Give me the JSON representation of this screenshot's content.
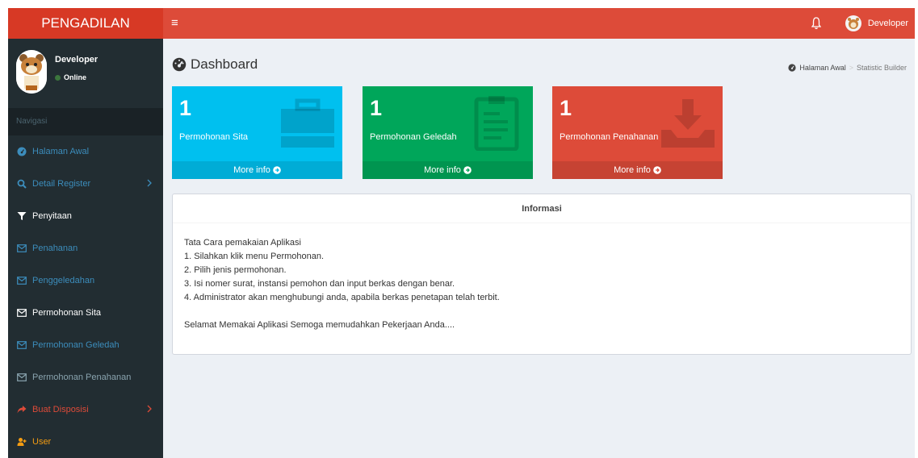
{
  "header": {
    "logo": "PENGADILAN",
    "toggle_icon": "≡",
    "user_label": "Developer"
  },
  "sidebar": {
    "user_name": "Developer",
    "user_status": "Online",
    "section_header": "Navigasi",
    "items": [
      {
        "label": "Halaman Awal",
        "icon": "dashboard-icon",
        "color": "#3c8dbc"
      },
      {
        "label": "Detail Register",
        "icon": "search-icon",
        "color": "#3c8dbc"
      },
      {
        "label": "Penyitaan",
        "icon": "filter-icon",
        "color": "#ffffff"
      },
      {
        "label": "Penahanan",
        "icon": "envelope-icon",
        "color": "#3c8dbc"
      },
      {
        "label": "Penggeledahan",
        "icon": "envelope-icon",
        "color": "#3c8dbc"
      },
      {
        "label": "Permohonan Sita",
        "icon": "envelope-icon",
        "color": "#ffffff"
      },
      {
        "label": "Permohonan Geledah",
        "icon": "envelope-icon",
        "color": "#3c8dbc"
      },
      {
        "label": "Permohonan Penahanan",
        "icon": "envelope-icon",
        "color": "#8aa4af"
      },
      {
        "label": "Buat Disposisi",
        "icon": "share-icon",
        "color": "#dd4b39"
      },
      {
        "label": "User",
        "icon": "user-plus-icon",
        "color": "#f39c12"
      }
    ]
  },
  "content": {
    "title": "Dashboard",
    "breadcrumb": [
      "Halaman Awal",
      "Statistic Builder"
    ]
  },
  "stats": [
    {
      "count": "1",
      "label": "Permohonan Sita",
      "more": "More info",
      "color": "#00c0ef",
      "icon": "briefcase-icon"
    },
    {
      "count": "1",
      "label": "Permohonan Geledah",
      "more": "More info",
      "color": "#00a65a",
      "icon": "clipboard-icon"
    },
    {
      "count": "1",
      "label": "Permohonan Penahanan",
      "more": "More info",
      "color": "#dd4b39",
      "icon": "download-tray-icon"
    }
  ],
  "info": {
    "heading": "Informasi",
    "lines": [
      "Tata Cara pemakaian Aplikasi",
      "1. Silahkan klik menu Permohonan.",
      "2. Pilih jenis permohonan.",
      "3. Isi nomer surat, instansi pemohon dan input berkas dengan benar.",
      "4. Administrator akan menghubungi anda, apabila berkas penetapan telah terbit."
    ],
    "footer": "Selamat Memakai Aplikasi Semoga memudahkan Pekerjaan Anda...."
  }
}
